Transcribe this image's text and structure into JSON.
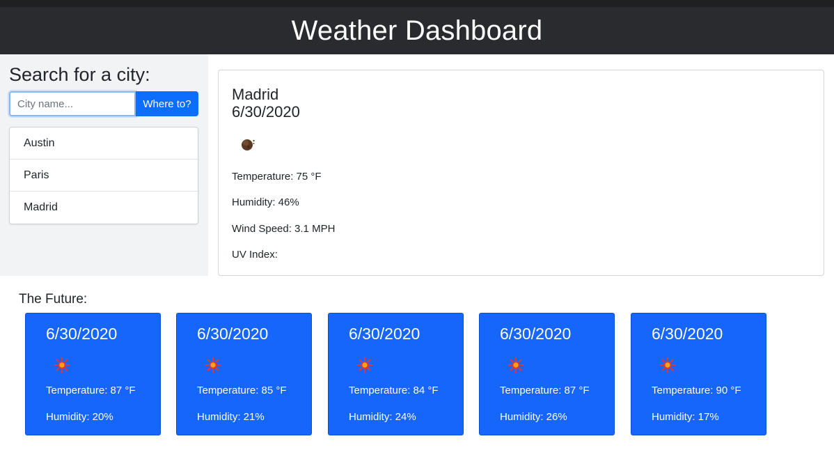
{
  "header": {
    "title": "Weather Dashboard"
  },
  "sidebar": {
    "heading": "Search for a city:",
    "search": {
      "placeholder": "City name...",
      "value": ""
    },
    "search_button": "Where to?",
    "history": [
      "Austin",
      "Paris",
      "Madrid"
    ]
  },
  "current": {
    "city": "Madrid",
    "date": "6/30/2020",
    "icon": "moon-icon",
    "temperature": "Temperature: 75 °F",
    "humidity": "Humidity: 46%",
    "wind": "Wind Speed: 3.1 MPH",
    "uv": "UV Index:"
  },
  "future": {
    "title": "The Future:",
    "days": [
      {
        "date": "6/30/2020",
        "icon": "sun-icon",
        "temperature": "Temperature: 87 °F",
        "humidity": "Humidity: 20%"
      },
      {
        "date": "6/30/2020",
        "icon": "sun-icon",
        "temperature": "Temperature: 85 °F",
        "humidity": "Humidity: 21%"
      },
      {
        "date": "6/30/2020",
        "icon": "sun-icon",
        "temperature": "Temperature: 84 °F",
        "humidity": "Humidity: 24%"
      },
      {
        "date": "6/30/2020",
        "icon": "sun-icon",
        "temperature": "Temperature: 87 °F",
        "humidity": "Humidity: 26%"
      },
      {
        "date": "6/30/2020",
        "icon": "sun-icon",
        "temperature": "Temperature: 90 °F",
        "humidity": "Humidity: 17%"
      }
    ]
  },
  "colors": {
    "header_bg": "#292b2e",
    "accent": "#0d6efd",
    "forecast_bg": "#1766fb",
    "sidebar_bg": "#f2f3f5"
  }
}
